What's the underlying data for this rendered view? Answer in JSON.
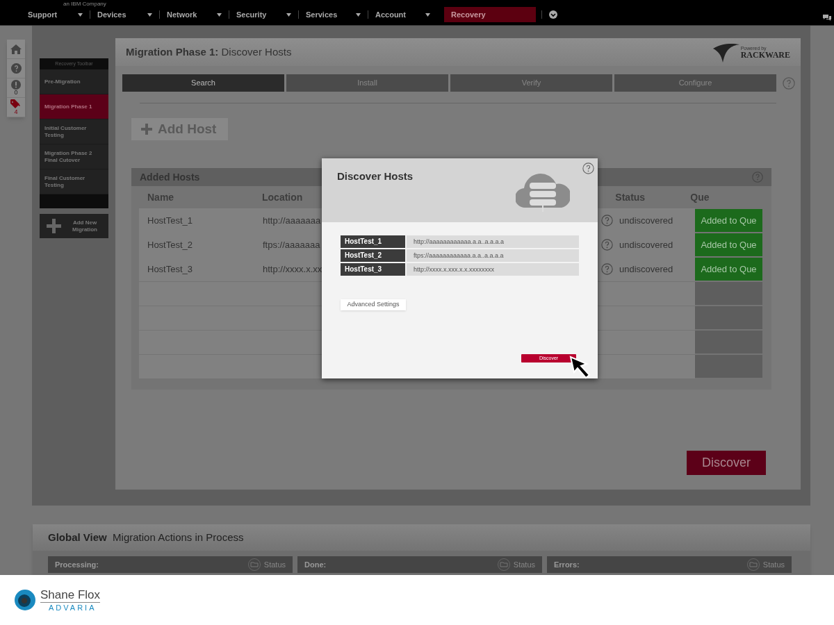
{
  "top_bar": {
    "tagline": "an IBM Company",
    "nav": [
      {
        "label": "Support",
        "selected": false
      },
      {
        "label": "Devices",
        "selected": false
      },
      {
        "label": "Network",
        "selected": false
      },
      {
        "label": "Security",
        "selected": false
      },
      {
        "label": "Services",
        "selected": false
      },
      {
        "label": "Account",
        "selected": false
      },
      {
        "label": "Recovery",
        "selected": true
      }
    ]
  },
  "icon_rail": [
    {
      "kind": "home"
    },
    {
      "kind": "help"
    },
    {
      "kind": "alert",
      "count": "0"
    },
    {
      "kind": "tag",
      "count": "4"
    }
  ],
  "recovery_toolbar": {
    "title": "Recovery Toolbar",
    "items": [
      {
        "label": "Pre-Migration",
        "selected": false
      },
      {
        "label": "Migration Phase 1",
        "selected": true
      },
      {
        "label": "Initial Customer Testing",
        "selected": false
      },
      {
        "label": "Migration Phase 2 Final Cutover",
        "selected": false
      },
      {
        "label": "Final Customer Testing",
        "selected": false
      }
    ],
    "add_button": "Add New Migration"
  },
  "main": {
    "title_bold": "Migration Phase 1:",
    "title": "Discover Hosts",
    "brand_tag": "Powered by",
    "brand": "RACKWARE",
    "tabs": [
      {
        "label": "Search",
        "selected": true
      },
      {
        "label": "Install",
        "selected": false
      },
      {
        "label": "Verify",
        "selected": false
      },
      {
        "label": "Configure",
        "selected": false
      }
    ],
    "add_host": "Add Host",
    "hosts_panel": {
      "title": "Added Hosts",
      "columns": [
        "Name",
        "Location",
        "Status",
        "Que"
      ],
      "rows": [
        {
          "name": "HostTest_1",
          "location": "http://aaaaaaa",
          "status": "undiscovered",
          "que": "Added to Que"
        },
        {
          "name": "HostTest_2",
          "location": "ftps://aaaaaaa",
          "status": "undiscovered",
          "que": "Added to Que"
        },
        {
          "name": "HostTest_3",
          "location": "http://xxxx.x.xx",
          "status": "undiscovered",
          "que": "Added to Que"
        }
      ]
    },
    "discover_button": "Discover"
  },
  "global_view": {
    "title_bold": "Global View",
    "title": "Migration Actions in Process",
    "columns": [
      {
        "label": "Processing:",
        "status": "Status"
      },
      {
        "label": "Done:",
        "status": "Status"
      },
      {
        "label": "Errors:",
        "status": "Status"
      }
    ]
  },
  "modal": {
    "title": "Discover Hosts",
    "hosts": [
      {
        "name": "HostTest_1",
        "url": "http://aaaaaaaaaaaa.a.a..a.a.a.a"
      },
      {
        "name": "HostTest_2",
        "url": "ftps://aaaaaaaaaaaa.a.a..a.a.a.a"
      },
      {
        "name": "HostTest_3",
        "url": "http://xxxx.x.xxx.x.x.xxxxxxxx"
      }
    ],
    "advanced_button": "Advanced Settings",
    "discover_button": "Discover"
  },
  "footer": {
    "name": "Shane Flox",
    "company": "ADVARIA"
  }
}
